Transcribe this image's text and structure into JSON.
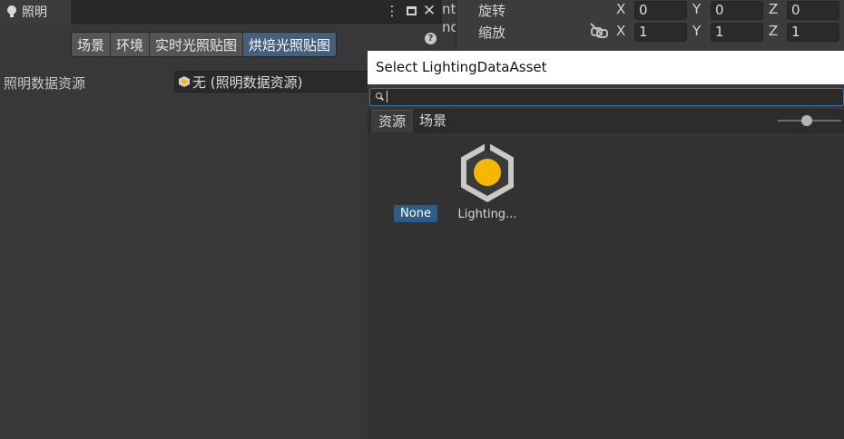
{
  "lighting_window": {
    "tab_title": "照明",
    "mode_tabs": [
      {
        "label": "场景"
      },
      {
        "label": "环境"
      },
      {
        "label": "实时光照贴图"
      },
      {
        "label": "烘焙光照贴图"
      }
    ],
    "active_tab_index": 3,
    "lighting_data_label": "照明数据资源",
    "lighting_data_value": "无 (照明数据资源)"
  },
  "background_inspector": {
    "partial_text_1": "nt",
    "partial_text_2": "nd",
    "rotation": {
      "label": "旋转",
      "x": "0",
      "y": "0",
      "z": "0"
    },
    "scale": {
      "label": "缩放",
      "x": "1",
      "y": "1",
      "z": "1"
    },
    "axis": {
      "x": "X",
      "y": "Y",
      "z": "Z"
    }
  },
  "object_picker": {
    "title": "Select LightingDataAsset",
    "search_value": "",
    "tabs": [
      {
        "label": "资源"
      },
      {
        "label": "场景"
      }
    ],
    "active_tab_index": 0,
    "items": [
      {
        "label": "None",
        "selected": true
      },
      {
        "label": "Lighting...",
        "icon": "lighting-data-asset-icon"
      }
    ]
  },
  "colors": {
    "accent": "#46607c",
    "selection": "#2c5d87",
    "asset_icon_yellow": "#f5b700"
  }
}
